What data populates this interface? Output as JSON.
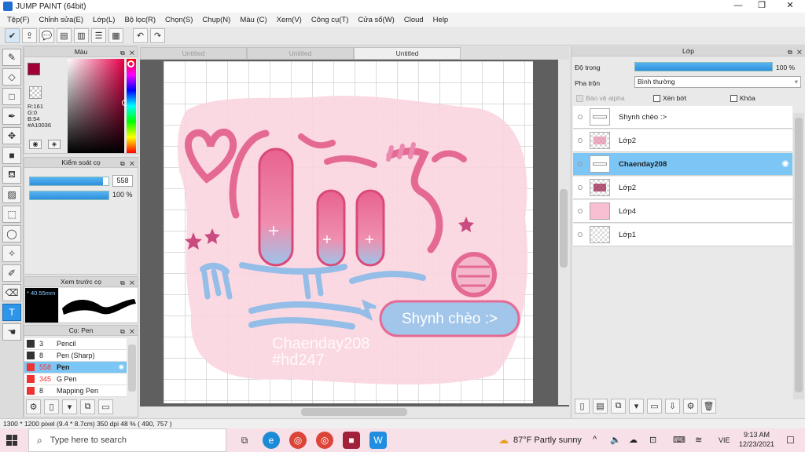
{
  "window": {
    "title": "JUMP PAINT (64bit)"
  },
  "menu": [
    "Tệp(F)",
    "Chỉnh sửa(E)",
    "Lớp(L)",
    "Bộ lọc(R)",
    "Chọn(S)",
    "Chụp(N)",
    "Màu (C)",
    "Xem(V)",
    "Công cụ(T)",
    "Cửa sổ(W)",
    "Cloud",
    "Help"
  ],
  "color_panel": {
    "title": "Màu",
    "r": "R:161",
    "g": "G:0",
    "b": "B:54",
    "hex": "#A10036",
    "main_color": "#a10036"
  },
  "brush_control": {
    "title": "Kiểm soát cọ",
    "size_value": "558",
    "opacity_value": "100 %",
    "size_fraction": 0.93,
    "opacity_fraction": 1.0
  },
  "preview_panel": {
    "title": "Xem trước cọ",
    "size_label": "* 40.55mm"
  },
  "brush_panel": {
    "title": "Cọ: Pen",
    "items": [
      {
        "size": "3",
        "name": "Pencil",
        "selected": false
      },
      {
        "size": "8",
        "name": "Pen (Sharp)",
        "selected": false
      },
      {
        "size": "558",
        "name": "Pen",
        "selected": true
      },
      {
        "size": "345",
        "name": "G Pen",
        "selected": false
      },
      {
        "size": "8",
        "name": "Mapping Pen",
        "selected": false
      }
    ]
  },
  "tabs": [
    "Untitled",
    "Untitled",
    "Untitled"
  ],
  "artwork": {
    "badge_text": "Shynh chèo :>",
    "watermark1": "Chaenday208",
    "watermark2": "#hd247"
  },
  "layer_panel": {
    "title": "Lớp",
    "opacity_label": "Độ trong",
    "opacity_value": "100 %",
    "opacity_fraction": 1.0,
    "blend_label": "Pha trộn",
    "blend_value": "Bình thường",
    "protect_alpha": "Bảo vệ alpha",
    "clip": "Xén bớt",
    "lock": "Khóa",
    "layers": [
      {
        "name": "Shynh chèo :>",
        "selected": false,
        "bold": false
      },
      {
        "name": "Lớp2",
        "selected": false,
        "bold": false
      },
      {
        "name": "Chaenday208",
        "selected": true,
        "bold": true
      },
      {
        "name": "Lớp2",
        "selected": false,
        "bold": false
      },
      {
        "name": "Lớp4",
        "selected": false,
        "bold": false
      },
      {
        "name": "Lớp1",
        "selected": false,
        "bold": false
      }
    ]
  },
  "status": {
    "text": "1300 * 1200 pixel  (9.4 * 8.7cm)  350 dpi  48 %  ( 490, 757 )"
  },
  "taskbar": {
    "search_placeholder": "Type here to search",
    "weather": "87°F  Partly sunny",
    "lang": "VIE",
    "time": "9:13 AM",
    "date": "12/23/2021"
  }
}
